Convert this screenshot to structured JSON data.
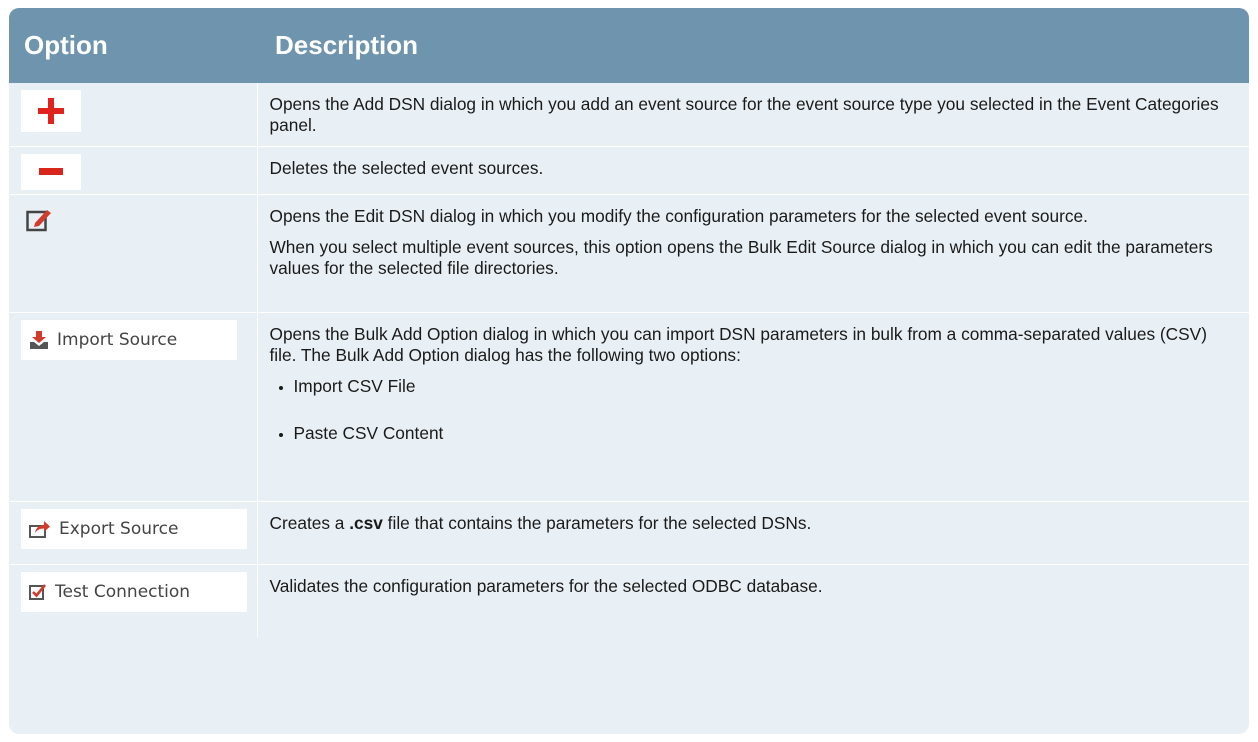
{
  "header": {
    "col_option": "Option",
    "col_description": "Description"
  },
  "rows": [
    {
      "icon": "plus-icon",
      "description": "Opens the Add DSN dialog in which you add an event source for the event source type you selected in the Event Categories panel."
    },
    {
      "icon": "minus-icon",
      "description": "Deletes the selected event sources."
    },
    {
      "icon": "edit-icon",
      "description": "Opens the Edit DSN dialog in which you modify the configuration parameters for the selected event source.",
      "description2": "When you select multiple event sources, this option opens the Bulk Edit Source dialog in which you can edit the parameters values for the selected file directories."
    },
    {
      "icon": "import-icon",
      "button_label": "Import Source",
      "description": "Opens the Bulk Add Option dialog in which you can import DSN parameters in bulk from a comma-separated values (CSV) file.  The Bulk Add Option dialog has the following two options:",
      "bullets": [
        "Import CSV File",
        "Paste CSV Content"
      ]
    },
    {
      "icon": "export-icon",
      "button_label": "Export Source",
      "description_pre": "Creates a ",
      "description_bold": ".csv",
      "description_post": " file that contains the parameters for the selected DSNs."
    },
    {
      "icon": "checkbox-icon",
      "button_label": "Test Connection",
      "description": "Validates the configuration parameters for the selected ODBC database."
    }
  ],
  "colors": {
    "header_bg": "#6e94ae",
    "row_bg": "#e9f0f5",
    "plus_red": "#e0231d",
    "minus_red": "#d9261c",
    "icon_red": "#d23a2b"
  }
}
